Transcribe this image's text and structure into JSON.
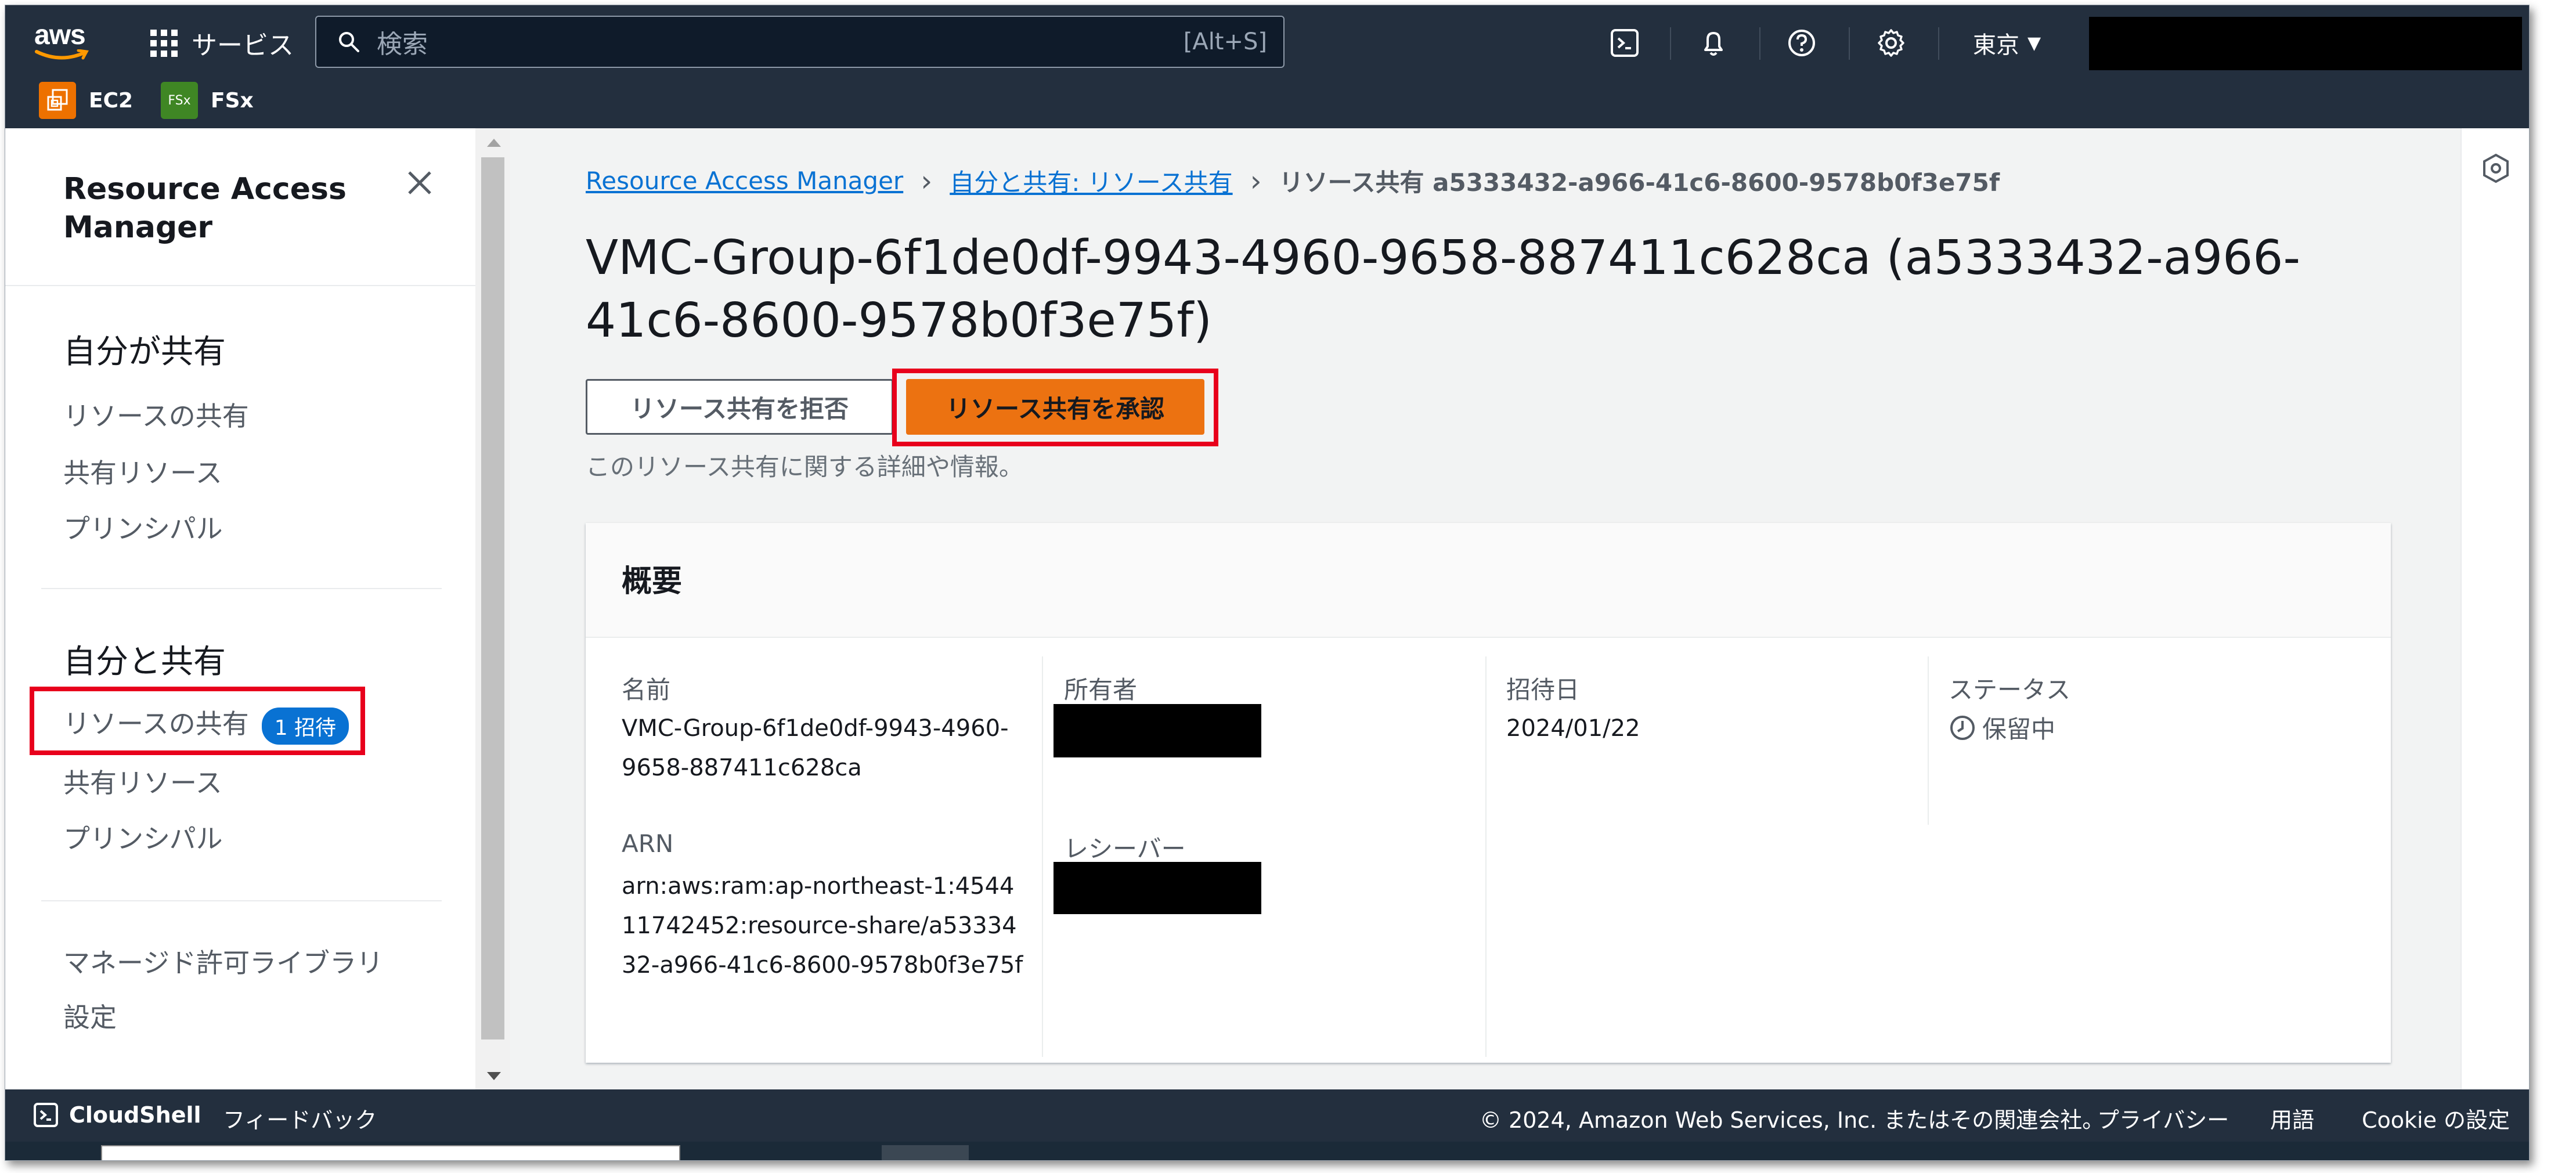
{
  "topnav": {
    "logo_text": "aws",
    "services_label": "サービス",
    "search_placeholder": "検索",
    "search_shortcut": "[Alt+S]",
    "region": "東京",
    "favorites": [
      {
        "label": "EC2",
        "icon_text": "",
        "color": "#ed7100"
      },
      {
        "label": "FSx",
        "icon_text": "FSx",
        "color": "#3f8624"
      }
    ]
  },
  "sidenav": {
    "title": "Resource Access Manager",
    "section1": {
      "heading": "自分が共有",
      "items": [
        "リソースの共有",
        "共有リソース",
        "プリンシパル"
      ]
    },
    "section2": {
      "heading": "自分と共有",
      "items": [
        "リソースの共有",
        "共有リソース",
        "プリンシパル"
      ],
      "badge": "1 招待"
    },
    "extra_items": [
      "マネージド許可ライブラリ",
      "設定"
    ]
  },
  "breadcrumb": {
    "items": [
      "Resource Access Manager",
      "自分と共有: リソース共有"
    ],
    "current": "リソース共有 a5333432-a966-41c6-8600-9578b0f3e75f"
  },
  "page": {
    "title": "VMC-Group-6f1de0df-9943-4960-9658-887411c628ca (a5333432-a966-41c6-8600-9578b0f3e75f)",
    "reject_button": "リソース共有を拒否",
    "accept_button": "リソース共有を承認",
    "description": "このリソース共有に関する詳細や情報。"
  },
  "summary": {
    "title": "概要",
    "name_label": "名前",
    "name_value": "VMC-Group-6f1de0df-9943-4960-9658-887411c628ca",
    "arn_label": "ARN",
    "arn_value": "arn:aws:ram:ap-northeast-1:454411742452:resource-share/a5333432-a966-41c6-8600-9578b0f3e75f",
    "owner_label": "所有者",
    "receiver_label": "レシーバー",
    "invited_label": "招待日",
    "invited_value": "2024/01/22",
    "status_label": "ステータス",
    "status_value": "保留中"
  },
  "footer": {
    "cloudshell": "CloudShell",
    "feedback": "フィードバック",
    "copyright": "© 2024, Amazon Web Services, Inc. またはその関連会社。",
    "privacy": "プライバシー",
    "terms": "用語",
    "cookie": "Cookie の設定"
  },
  "colors": {
    "nav_bg": "#232f3e",
    "accent_orange": "#ec7211",
    "link_blue": "#0972d3",
    "badge_blue": "#0972d3",
    "highlight_red": "#e8001c"
  }
}
